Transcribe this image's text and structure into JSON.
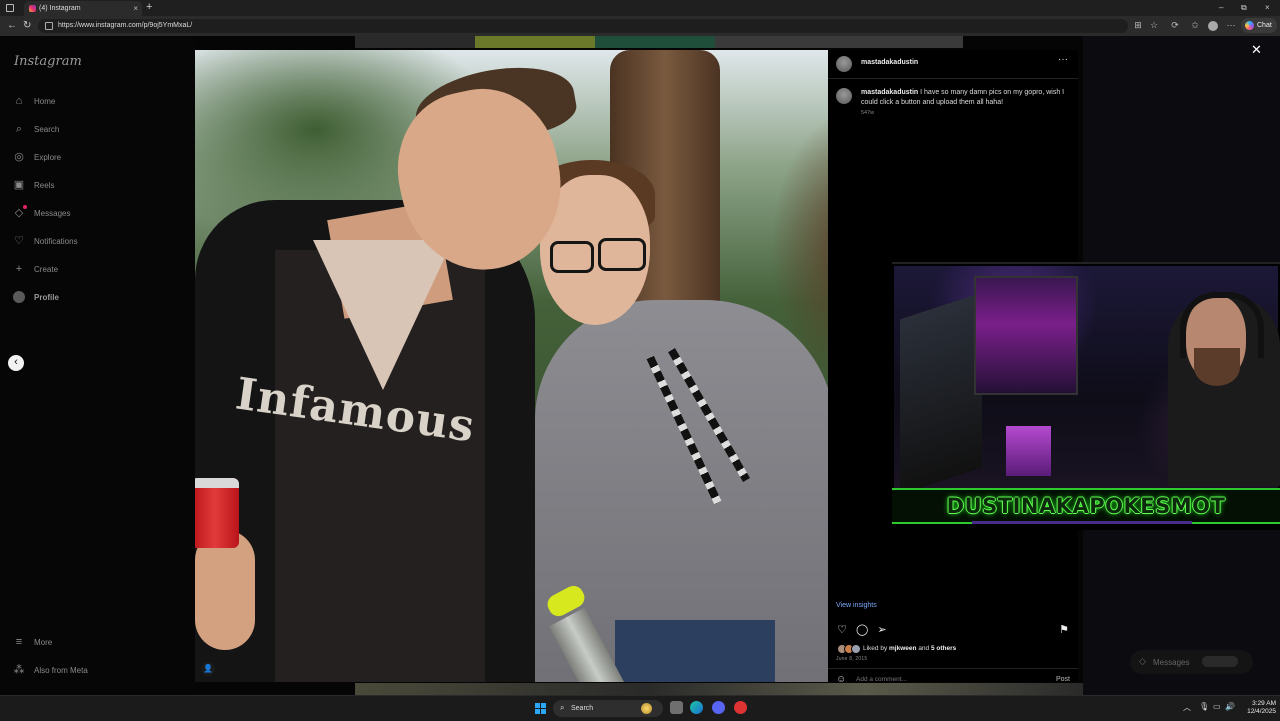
{
  "browser": {
    "tab_title": "(4) Instagram",
    "tab_close": "×",
    "new_tab": "+",
    "url": "https://www.instagram.com/p/9oj5YmMxaL/",
    "chat_label": "Chat",
    "window_controls": {
      "minimize": "–",
      "restore": "⧉",
      "close": "×"
    }
  },
  "sidebar": {
    "logo": "Instagram",
    "items": [
      {
        "label": "Home",
        "icon": "home-icon",
        "glyph": "⌂"
      },
      {
        "label": "Search",
        "icon": "search-icon",
        "glyph": "⌕"
      },
      {
        "label": "Explore",
        "icon": "compass-icon",
        "glyph": "◎"
      },
      {
        "label": "Reels",
        "icon": "reels-icon",
        "glyph": "▣"
      },
      {
        "label": "Messages",
        "icon": "messenger-icon",
        "glyph": "◇"
      },
      {
        "label": "Notifications",
        "icon": "heart-icon",
        "glyph": "♡"
      },
      {
        "label": "Create",
        "icon": "plus-icon",
        "glyph": "+"
      },
      {
        "label": "Profile",
        "icon": "profile-avatar"
      }
    ],
    "more": "More",
    "meta": "Also from Meta"
  },
  "post": {
    "username": "mastadakadustin",
    "more_glyph": "···",
    "caption_user": "mastadakadustin",
    "caption": "I have so many damn pics on my gopro, wish I could click a button and upload them all haha!",
    "age": "547w",
    "photo_text": "Infamous",
    "view_insights": "View insights",
    "liked_prefix": "Liked by",
    "liked_user": "mjkween",
    "liked_and": "and",
    "liked_others": "5 others",
    "date": "June 8, 2015",
    "comment_placeholder": "Add a comment...",
    "post_button": "Post",
    "actions": {
      "like": "♡",
      "comment": "◯",
      "share": "➢",
      "save": "⚑"
    }
  },
  "overlay": {
    "close": "✕",
    "prev": "‹",
    "messages_float": "Messages"
  },
  "webcam": {
    "banner": "DUSTINAKAPOKESMOT"
  },
  "taskbar": {
    "search": "Search",
    "time": "3:29 AM",
    "date": "12/4/2025"
  },
  "colors": {
    "accent_link": "#7aa9ff",
    "banner_green": "#62ff52",
    "notification_red": "#e0245e"
  }
}
